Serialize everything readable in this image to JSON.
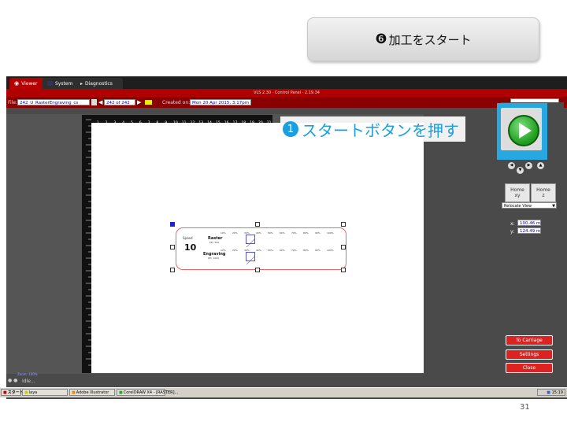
{
  "step_header": {
    "badge": "❻",
    "label": "加工をスタート"
  },
  "app": {
    "tabs": [
      {
        "label": "Viewer"
      },
      {
        "label": "System"
      },
      {
        "label": "Diagnostics"
      }
    ],
    "title": "VLS 2.30 · Control Panel · 2.19.34",
    "file_label": "File:",
    "file_value": "242_U_RasterEngraving_cs",
    "counter": "242 of 242",
    "created_label": "Created on:",
    "created_value": "Mon 20 Apr 2015,  3:17pm",
    "ruler_top_numbers": [
      "0",
      "1",
      "2",
      "3",
      "4",
      "5",
      "6",
      "7",
      "8",
      "9",
      "10",
      "11",
      "12",
      "13",
      "14",
      "15",
      "16",
      "17",
      "18",
      "19",
      "20",
      "21"
    ],
    "zoom_label": "Zoom: 100%",
    "status": "Idle..."
  },
  "design": {
    "title_big": "10",
    "title_small": "Speed",
    "raster_label": "Raster",
    "engraving_label": "Engraving",
    "percent_row": [
      "10%",
      "20%",
      "30%",
      "40%",
      "50%",
      "60%",
      "70%",
      "80%",
      "90%",
      "100%"
    ],
    "raster_sub": "PPI: 500",
    "eng_sub": "PPI: 1000"
  },
  "callout": {
    "num": "1",
    "text": "スタートボタンを押す"
  },
  "right_panel": {
    "home_xy": {
      "top": "Home",
      "bottom": "xy"
    },
    "home_z": {
      "top": "Home",
      "bottom": "z"
    },
    "relocate": "Relocate View",
    "x_label": "x:",
    "x_value": "100.46 mm",
    "y_label": "y:",
    "y_value": "124.49 mm",
    "to_carriage": "To Carriage",
    "settings": "Settings",
    "close": "Close"
  },
  "taskbar": {
    "start": "スタート",
    "items": [
      "laya",
      "Adobe Illustrator",
      "CorelDRAW X4 - [RASTER]..."
    ],
    "clock": "15:19"
  },
  "slide_number": "31"
}
